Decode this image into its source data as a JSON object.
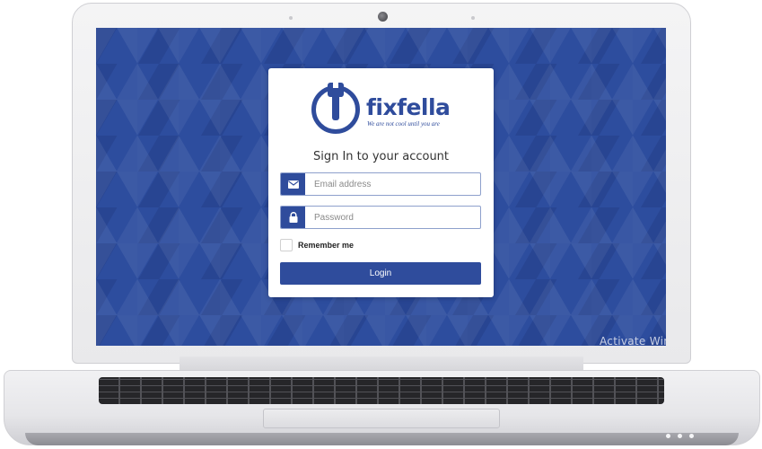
{
  "brand": {
    "name": "fixfella",
    "tagline": "We are not cool until you are",
    "logo_icon": "power-wrench-icon",
    "color": "#2f4c9c"
  },
  "login": {
    "heading": "Sign In to your account",
    "email": {
      "placeholder": "Email address",
      "value": "",
      "icon": "envelope-icon"
    },
    "password": {
      "placeholder": "Password",
      "value": "",
      "icon": "lock-icon"
    },
    "remember_label": "Remember me",
    "remember_checked": false,
    "submit_label": "Login"
  },
  "system": {
    "watermark": "Activate Windows"
  },
  "colors": {
    "screen_background": "#2d4d9e",
    "accent": "#2f4c9c",
    "card": "#ffffff"
  }
}
